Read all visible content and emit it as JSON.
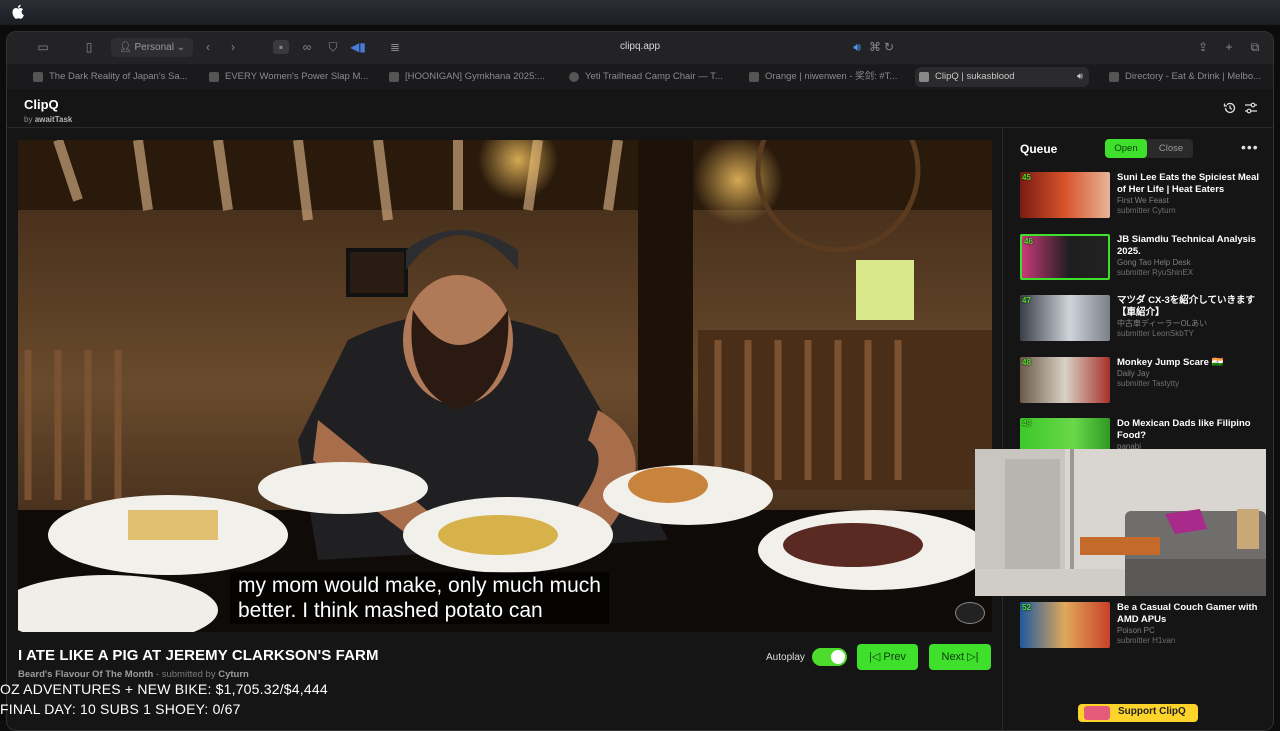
{
  "browser": {
    "url": "clipq.app",
    "profile_label": "Personal",
    "tabs": [
      {
        "label": "The Dark Reality of Japan's Sa..."
      },
      {
        "label": "EVERY Women's Power Slap M..."
      },
      {
        "label": "[HOONIGAN] Gymkhana 2025:..."
      },
      {
        "label": "Yeti Trailhead Camp Chair — T..."
      },
      {
        "label": "Orange | niwenwen - 奖剑: #T..."
      },
      {
        "label": "ClipQ | sukasblood"
      },
      {
        "label": "Directory - Eat & Drink | Melbo..."
      }
    ]
  },
  "app": {
    "name": "ClipQ",
    "by_prefix": "by",
    "by_author": "awaitTask"
  },
  "video": {
    "caption_line1": "my mom would make, only much much",
    "caption_line2": "better. I think mashed potato can",
    "title": "I ATE LIKE A PIG AT JEREMY CLARKSON'S FARM",
    "channel": "Beard's Flavour Of The Month",
    "submitted_prefix": " - submitted by ",
    "submitter": "Cyturn"
  },
  "controls": {
    "autoplay_label": "Autoplay",
    "autoplay_on": true,
    "prev_label": "Prev",
    "next_label": "Next"
  },
  "queue": {
    "title": "Queue",
    "open_label": "Open",
    "close_label": "Close",
    "more_label": "•••",
    "items": [
      {
        "num": "45",
        "title": "Suni Lee Eats the Spiciest Meal of Her Life | Heat Eaters",
        "channel": "First We Feast",
        "submitter": "submitter Cyturn"
      },
      {
        "num": "46",
        "title": "JB Siamdiu Technical Analysis 2025.",
        "channel": "Gong Tao Help Desk",
        "submitter": "submitter RyuShinEX"
      },
      {
        "num": "47",
        "title": "マツダ CX-3を紹介していきます【車紹介】",
        "channel": "中古車ディーラーOLあい",
        "submitter": "submitter LeonSkbTY"
      },
      {
        "num": "48",
        "title": "Monkey Jump Scare 🇮🇳",
        "channel": "Daily Jay",
        "submitter": "submitter Tastytty"
      },
      {
        "num": "49",
        "title": "Do Mexican Dads like Filipino Food?",
        "channel": "panabi",
        "submitter": ""
      },
      {
        "num": "52",
        "title": "Be a Casual Couch Gamer with AMD APUs",
        "channel": "Poison PC",
        "submitter": "submitter H1van"
      }
    ]
  },
  "overlay": {
    "line1": "OZ ADVENTURES + NEW BIKE: $1,705.32/$4,444",
    "line2": "FINAL DAY: 10 SUBS 1 SHOEY: 0/67"
  },
  "support_label": "Support ClipQ",
  "colors": {
    "accent": "#3ee02b",
    "background": "#151515"
  }
}
